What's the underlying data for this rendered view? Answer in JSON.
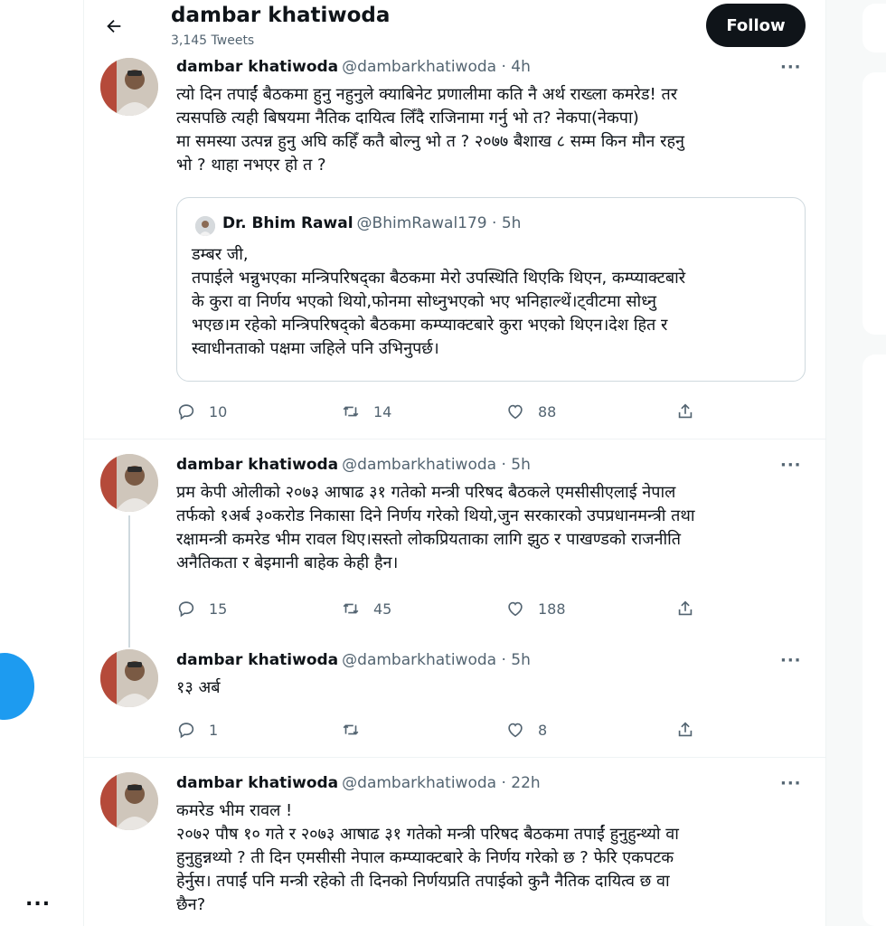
{
  "header": {
    "name": "dambar khatiwoda",
    "tweet_count": "3,145 Tweets",
    "follow_label": "Follow"
  },
  "icons": {
    "back": "arrow-left-icon",
    "reply": "reply-icon",
    "retweet": "retweet-icon",
    "like": "heart-icon",
    "share": "share-icon",
    "more": "more-horizontal-icon"
  },
  "colors": {
    "accent": "#1d9bf0",
    "text": "#0f1419",
    "secondary": "#536471",
    "button": "#0f1419"
  },
  "left_rail": {
    "more_label": "..."
  },
  "tweets": [
    {
      "name": "dambar khatiwoda",
      "handle": "@dambarkhatiwoda · 4h",
      "more": "···",
      "body": "त्यो दिन तपाईं बैठकमा हुनु नहुनुले क्याबिनेट प्रणालीमा कति नै अर्थ राख्ला कमरेड! तर\nत्यसपछि त्यही बिषयमा नैतिक दायित्व लिँदै राजिनामा गर्नु भो त?  नेकपा(नेकपा)\n मा समस्या उत्पन्न हुनु अघि कहिँ कतै बोल्नु भो त ? २०७७ बैशाख ८ सम्म किन मौन रहनु\nभो ? थाहा नभएर हो त ?",
      "quote": {
        "name": "Dr. Bhim Rawal",
        "handle": "@BhimRawal179 · 5h",
        "body": "डम्बर जी,\nतपाईले भन्नुभएका मन्त्रिपरिषद्का बैठकमा मेरो उपस्थिति थिएकि थिएन, कम्प्याक्टबारे\nके कुरा वा निर्णय भएको थियो,फोनमा सोध्नुभएको भए भनिहाल्थें।ट्वीटमा सोध्नु\nभएछ।म रहेको मन्त्रिपरिषद्को बैठकमा कम्प्याक्टबारे कुरा भएको थिएन।देश हित र\nस्वाधीनताको पक्षमा जहिले पनि उभिनुपर्छ।"
      },
      "replies": "10",
      "retweets": "14",
      "likes": "88"
    },
    {
      "name": "dambar khatiwoda",
      "handle": "@dambarkhatiwoda · 5h",
      "more": "···",
      "body": "प्रम केपी ओलीको २०७३ आषाढ ३१ गतेको  मन्त्री परिषद बैठकले एमसीसीएलाई नेपाल\nतर्फको १अर्ब ३०करोड निकासा दिने निर्णय गरेको थियो,जुन सरकारको उपप्रधानमन्त्री तथा\nरक्षामन्त्री कमरेड भीम रावल थिए।सस्तो लोकप्रियताका लागि झुठ र पाखण्डको राजनीति\nअनैतिकता र बेइमानी बाहेक केही हैन।",
      "replies": "15",
      "retweets": "45",
      "likes": "188"
    },
    {
      "name": "dambar khatiwoda",
      "handle": "@dambarkhatiwoda · 5h",
      "more": "···",
      "body": "१३ अर्ब",
      "replies": "1",
      "retweets": "",
      "likes": "8"
    },
    {
      "name": "dambar khatiwoda",
      "handle": "@dambarkhatiwoda · 22h",
      "more": "···",
      "body": "कमरेड भीम रावल !\n २०७२ पौष १० गते  र २०७३ आषाढ ३१ गतेको मन्त्री परिषद बैठकमा तपाईं हुनुहुन्थ्यो वा\nहुनुहुन्नथ्यो ?  ती दिन एमसीसी नेपाल कम्प्याक्टबारे  के निर्णय गरेको छ ? फेरि एकपटक\nहेर्नुस। तपाईं पनि मन्त्री रहेको ती दिनको निर्णयप्रति तपाईको कुनै नैतिक दायित्व छ वा\nछैन?"
    }
  ]
}
